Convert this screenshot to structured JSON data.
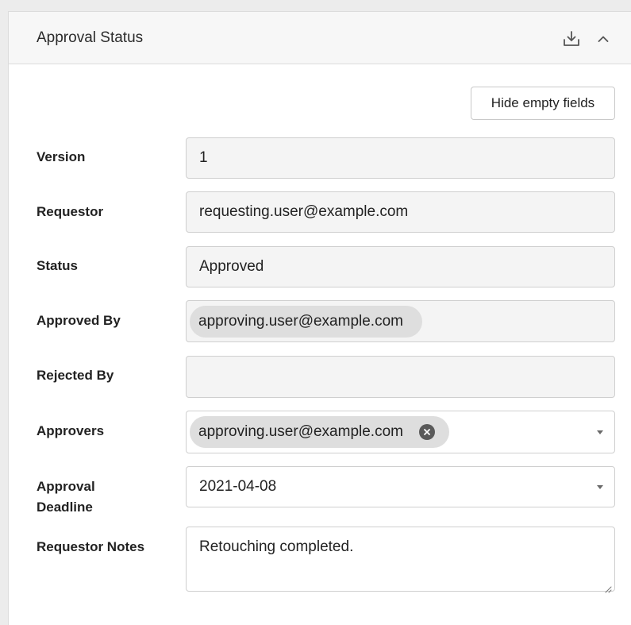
{
  "panel": {
    "title": "Approval Status",
    "icons": [
      "download-icon",
      "chevron-up-icon"
    ],
    "hide_empty_label": "Hide empty fields"
  },
  "fields": {
    "version": {
      "label": "Version",
      "value": "1"
    },
    "requestor": {
      "label": "Requestor",
      "value": "requesting.user@example.com"
    },
    "status": {
      "label": "Status",
      "value": "Approved"
    },
    "approved_by": {
      "label": "Approved By",
      "chip": "approving.user@example.com"
    },
    "rejected_by": {
      "label": "Rejected By",
      "value": ""
    },
    "approvers": {
      "label": "Approvers",
      "chip": "approving.user@example.com"
    },
    "approval_deadline": {
      "label_line1": "Approval",
      "label_line2": "Deadline",
      "value": "2021-04-08"
    },
    "requestor_notes": {
      "label": "Requestor Notes",
      "value": "Retouching completed."
    }
  },
  "colors": {
    "header_bg": "#f7f7f7",
    "field_bg": "#f4f4f4",
    "chip_bg": "#dedede",
    "border": "#cfcfcf"
  }
}
